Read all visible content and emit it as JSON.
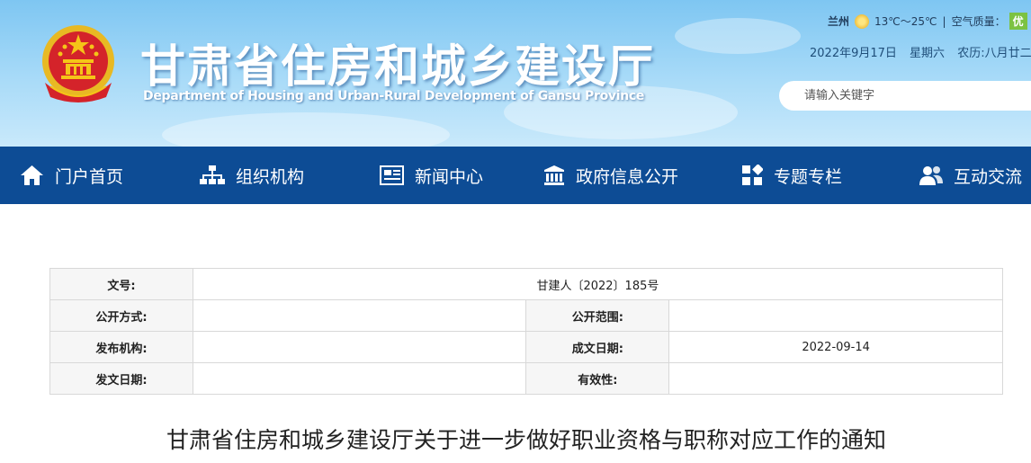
{
  "header": {
    "site_title": "甘肃省住房和城乡建设厅",
    "site_subtitle": "Department of Housing and Urban-Rural Development of Gansu Province",
    "weather": {
      "city": "兰州",
      "temperature": "13℃～25℃",
      "separator": "|",
      "air_quality_label": "空气质量：",
      "air_quality_value": "优"
    },
    "date": {
      "gregorian": "2022年9月17日",
      "weekday": "星期六",
      "lunar": "农历:八月廿二"
    },
    "search": {
      "placeholder": "请输入关键字"
    }
  },
  "nav": {
    "items": [
      {
        "label": "门户首页",
        "icon": "home-icon"
      },
      {
        "label": "组织机构",
        "icon": "org-chart-icon"
      },
      {
        "label": "新闻中心",
        "icon": "news-icon"
      },
      {
        "label": "政府信息公开",
        "icon": "government-building-icon"
      },
      {
        "label": "专题专栏",
        "icon": "grid-icon"
      },
      {
        "label": "互动交流",
        "icon": "users-icon"
      }
    ]
  },
  "doc_info": {
    "doc_number_label": "文号:",
    "doc_number_value": "甘建人〔2022〕185号",
    "disclosure_method_label": "公开方式:",
    "disclosure_method_value": "",
    "disclosure_scope_label": "公开范围:",
    "disclosure_scope_value": "",
    "issuing_org_label": "发布机构:",
    "issuing_org_value": "",
    "creation_date_label": "成文日期:",
    "creation_date_value": "2022-09-14",
    "issue_date_label": "发文日期:",
    "issue_date_value": "",
    "validity_label": "有效性:",
    "validity_value": ""
  },
  "article": {
    "title": "甘肃省住房和城乡建设厅关于进一步做好职业资格与职称对应工作的通知"
  },
  "colors": {
    "nav_bg": "#0d4c95",
    "header_sky": "#a9dbf8",
    "emblem_red": "#d4232a",
    "emblem_gold": "#f5c518",
    "aq_green": "#7cc242"
  }
}
